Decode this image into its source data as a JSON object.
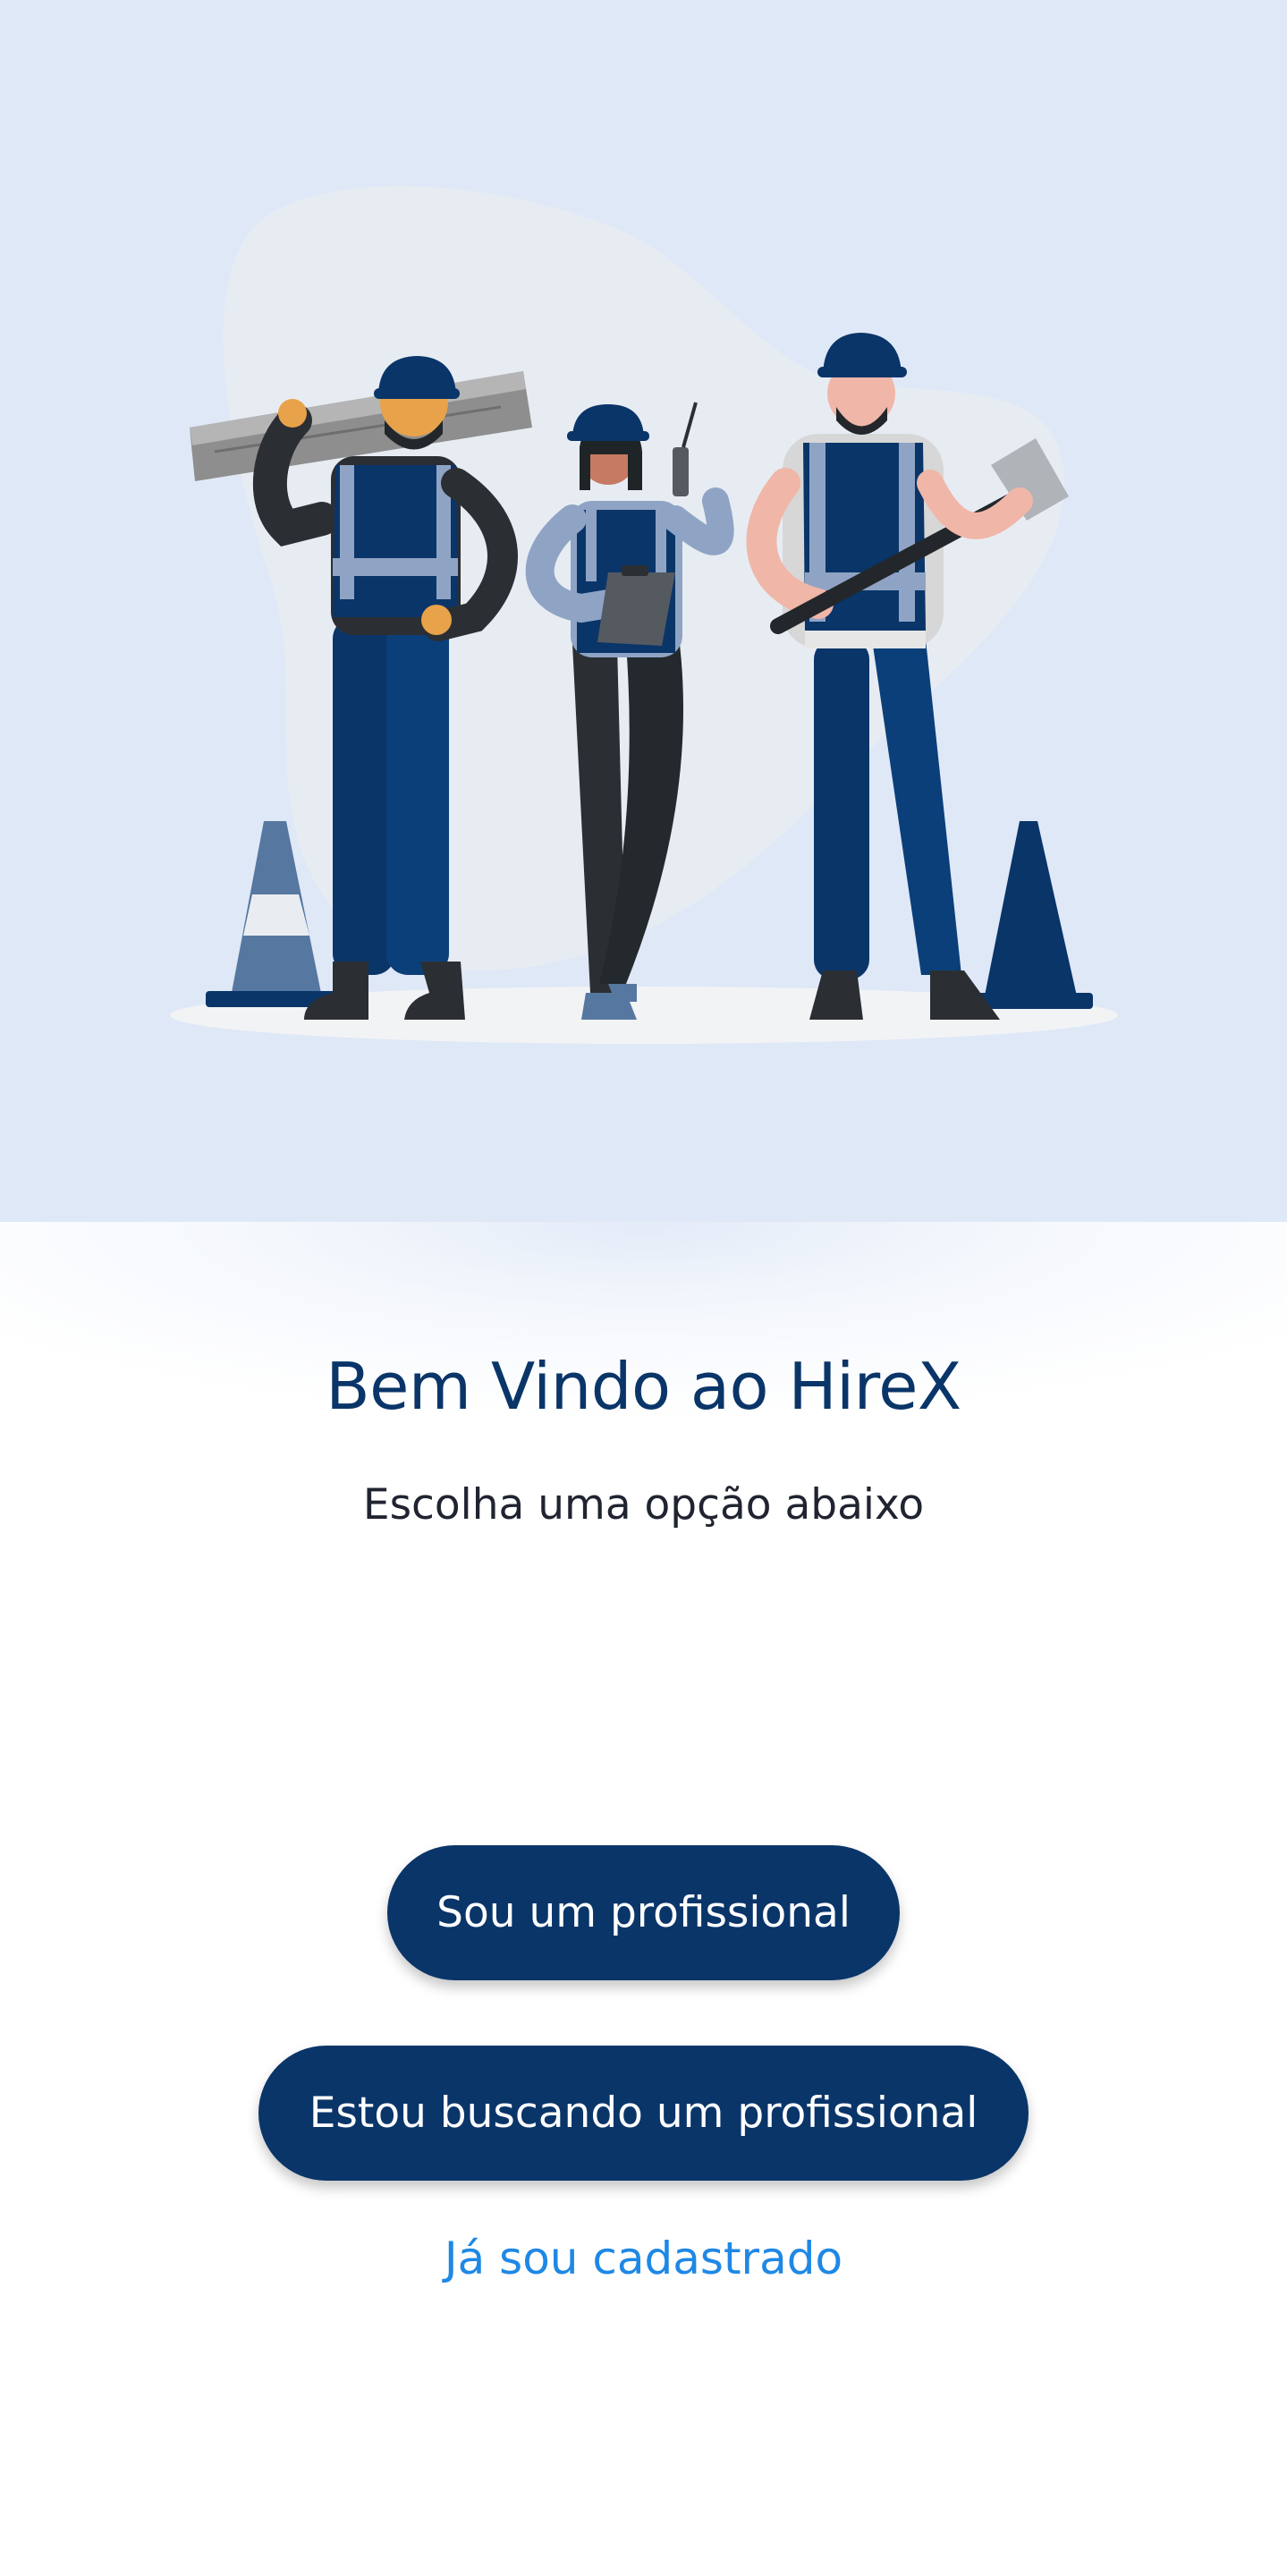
{
  "welcome": {
    "title": "Bem Vindo ao HireX",
    "subtitle": "Escolha uma opção abaixo"
  },
  "actions": {
    "professional_label": "Sou um profissional",
    "seeking_label": "Estou buscando um profissional",
    "registered_label": "Já sou cadastrado"
  },
  "colors": {
    "brand_navy": "#0a3569",
    "link_blue": "#1e88e5",
    "hero_background": "#dfe8f7"
  }
}
